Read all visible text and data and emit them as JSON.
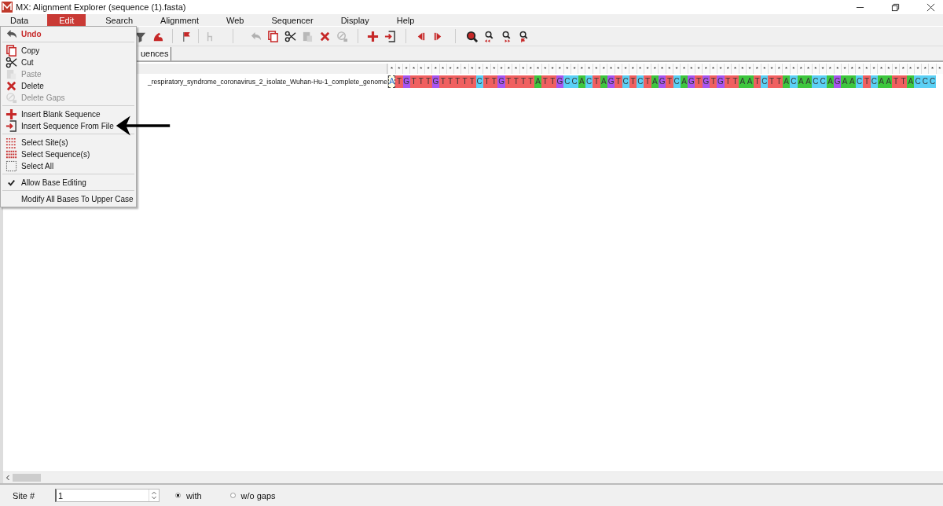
{
  "window": {
    "title": "MX: Alignment Explorer (sequence (1).fasta)"
  },
  "menu_bar": [
    {
      "label": "Data",
      "selected": false
    },
    {
      "label": "Edit",
      "selected": true
    },
    {
      "label": "Search",
      "selected": false
    },
    {
      "label": "Alignment",
      "selected": false
    },
    {
      "label": "Web",
      "selected": false
    },
    {
      "label": "Sequencer",
      "selected": false
    },
    {
      "label": "Display",
      "selected": false
    },
    {
      "label": "Help",
      "selected": false
    }
  ],
  "toolbar": [
    {
      "disabled": false
    },
    {
      "disabled": false
    },
    {
      "disabled": false
    },
    {
      "disabled": true
    },
    {
      "disabled": true
    },
    {
      "disabled": false
    },
    {
      "disabled": false
    },
    {
      "disabled": true
    },
    {
      "disabled": false
    },
    {
      "disabled": true
    },
    {
      "disabled": false
    },
    {
      "disabled": false
    },
    {
      "disabled": false
    },
    {
      "disabled": false
    },
    {
      "disabled": false
    },
    {
      "disabled": false
    },
    {
      "disabled": false
    },
    {
      "disabled": false
    }
  ],
  "tab": {
    "label": "uences"
  },
  "alignment": {
    "conservation": "* * * * * * * * * * * * * * * * * * * * * * * * * * * * * * * * * * * * * * * * * * * * * * * * * * * * * * * * * * * * * * * * * * * * * * * * * * * *",
    "sequence_name": "_respiratory_syndrome_coronavirus_2_isolate_Wuhan-Hu-1_complete_genome",
    "focused_base": "A",
    "bases": "T G T T T G T T T T T C T T G T T T T A T T G C C A C T A G T C T C T A G T C A G T G T G T T A A T C T T A C A A C C A G A A C T C A A T T A C C C"
  },
  "edit_menu": {
    "groups": [
      [
        {
          "label": "Undo",
          "disabled": false,
          "selected": true,
          "checked": false
        }
      ],
      [
        {
          "label": "Copy",
          "disabled": false,
          "selected": false,
          "checked": false
        },
        {
          "label": "Cut",
          "disabled": false,
          "selected": false,
          "checked": false
        },
        {
          "label": "Paste",
          "disabled": true,
          "selected": false,
          "checked": false
        },
        {
          "label": "Delete",
          "disabled": false,
          "selected": false,
          "checked": false
        },
        {
          "label": "Delete Gaps",
          "disabled": true,
          "selected": false,
          "checked": false
        }
      ],
      [
        {
          "label": "Insert Blank Sequence",
          "disabled": false,
          "selected": false,
          "checked": false
        },
        {
          "label": "Insert Sequence From File",
          "disabled": false,
          "selected": false,
          "checked": false
        }
      ],
      [
        {
          "label": "Select Site(s)",
          "disabled": false,
          "selected": false,
          "checked": false
        },
        {
          "label": "Select Sequence(s)",
          "disabled": false,
          "selected": false,
          "checked": false
        },
        {
          "label": "Select All",
          "disabled": false,
          "selected": false,
          "checked": false
        }
      ],
      [
        {
          "label": "Allow Base Editing",
          "disabled": false,
          "selected": false,
          "checked": true
        }
      ],
      [
        {
          "label": "Modify All Bases To Upper Case",
          "disabled": false,
          "selected": false,
          "checked": false
        }
      ]
    ]
  },
  "status_bar": {
    "site_label": "Site #",
    "site_value": "1",
    "radios": [
      {
        "label": "with",
        "selected": true
      },
      {
        "label": "w/o gaps",
        "selected": false
      }
    ]
  }
}
